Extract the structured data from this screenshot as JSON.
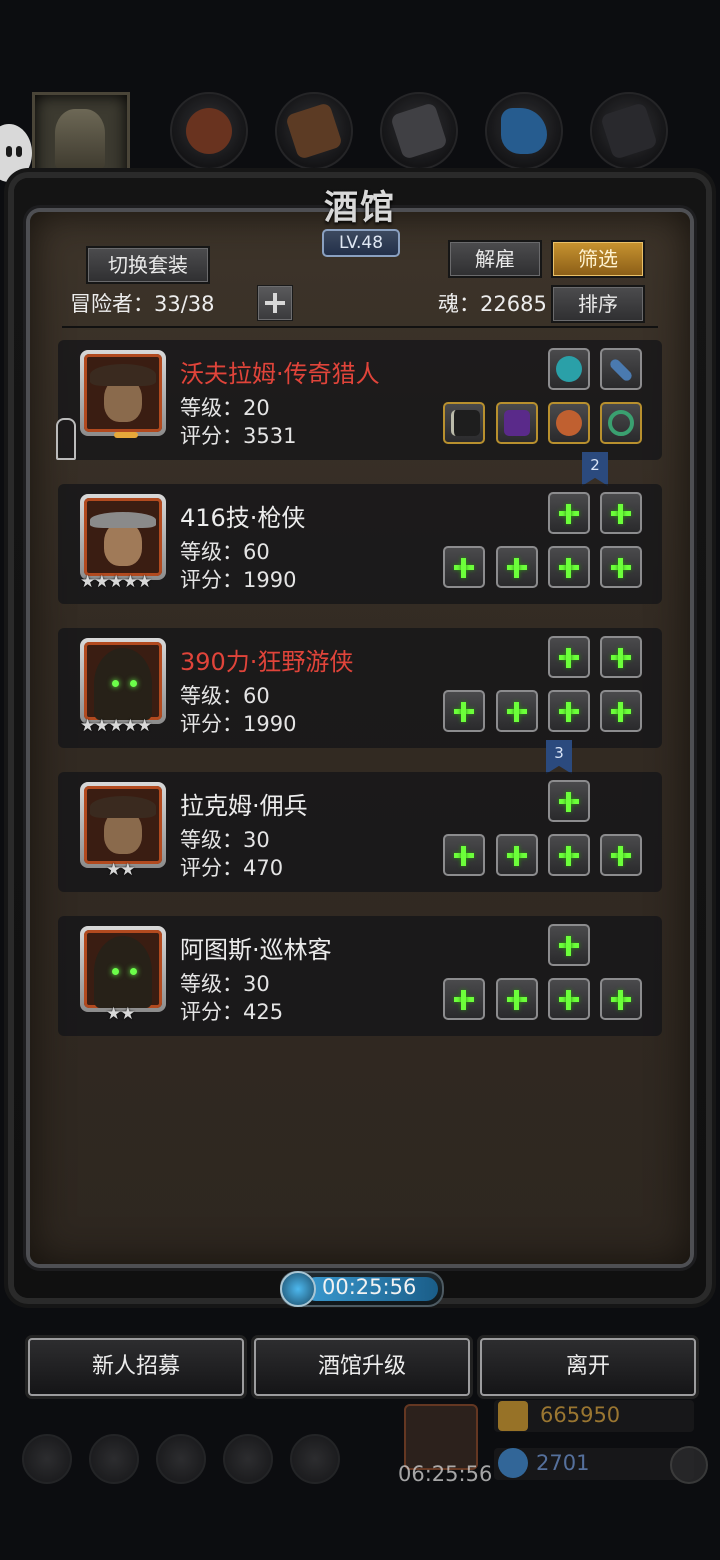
{
  "tavern": {
    "title": "酒馆",
    "level": "LV.48",
    "switch_outfit": "切换套装",
    "dismiss": "解雇",
    "filter": "筛选",
    "adventurers": "冒险者：33/38",
    "soul": "魂：22685",
    "sort": "排序"
  },
  "heroes": [
    {
      "name": "沃夫拉姆·传奇猎人",
      "level": "等级：20",
      "score": "评分：3531",
      "stars": "",
      "name_color": "#e0443a"
    },
    {
      "name": "416技·枪侠",
      "level": "等级：60",
      "score": "评分：1990",
      "stars": "★★★★★",
      "name_color": "#ececec"
    },
    {
      "name": "390力·狂野游侠",
      "level": "等级：60",
      "score": "评分：1990",
      "stars": "★★★★★",
      "name_color": "#e0443a"
    },
    {
      "name": "拉克姆·佣兵",
      "level": "等级：30",
      "score": "评分：470",
      "stars": "★★",
      "name_color": "#ececec"
    },
    {
      "name": "阿图斯·巡林客",
      "level": "等级：30",
      "score": "评分：425",
      "stars": "★★",
      "name_color": "#ececec"
    }
  ],
  "ribbons": [
    "2",
    "3"
  ],
  "timers": {
    "tavern_timer": "00:25:56",
    "gift_timer": "06:25:56"
  },
  "resources": {
    "gold": "665950",
    "gems": "2701"
  },
  "bottom_buttons": {
    "recruit": "新人招募",
    "upgrade": "酒馆升级",
    "leave": "离开"
  },
  "colors": {
    "accent_gold": "#c89430",
    "plus_green": "#6cff3a",
    "red_name": "#e0443a"
  }
}
